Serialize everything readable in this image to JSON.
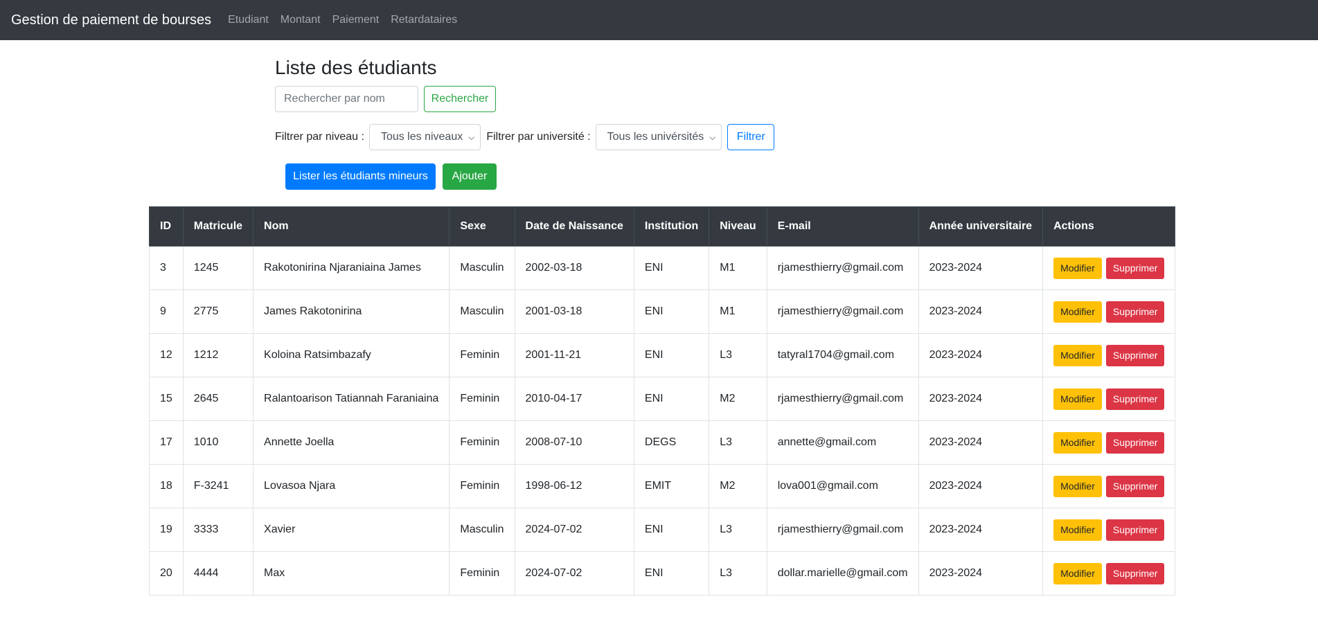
{
  "navbar": {
    "brand": "Gestion de paiement de bourses",
    "links": [
      "Etudiant",
      "Montant",
      "Paiement",
      "Retardataires"
    ]
  },
  "page": {
    "title": "Liste des étudiants"
  },
  "search": {
    "placeholder": "Rechercher par nom",
    "button": "Rechercher"
  },
  "filters": {
    "level_label": "Filtrer par niveau :",
    "level_selected": "Tous les niveaux",
    "university_label": "Filtrer par université :",
    "university_selected": "Tous les univérsités",
    "button": "Filtrer"
  },
  "actions": {
    "minors_button": "Lister les étudiants mineurs",
    "add_button": "Ajouter"
  },
  "table": {
    "headers": [
      "ID",
      "Matricule",
      "Nom",
      "Sexe",
      "Date de Naissance",
      "Institution",
      "Niveau",
      "E-mail",
      "Année universitaire",
      "Actions"
    ],
    "edit_label": "Modifier",
    "delete_label": "Supprimer",
    "rows": [
      [
        "3",
        "1245",
        "Rakotonirina Njaraniaina James",
        "Masculin",
        "2002-03-18",
        "ENI",
        "M1",
        "rjamesthierry@gmail.com",
        "2023-2024"
      ],
      [
        "9",
        "2775",
        "James Rakotonirina",
        "Masculin",
        "2001-03-18",
        "ENI",
        "M1",
        "rjamesthierry@gmail.com",
        "2023-2024"
      ],
      [
        "12",
        "1212",
        "Koloina Ratsimbazafy",
        "Feminin",
        "2001-11-21",
        "ENI",
        "L3",
        "tatyral1704@gmail.com",
        "2023-2024"
      ],
      [
        "15",
        "2645",
        "Ralantoarison Tatiannah Faraniaina",
        "Feminin",
        "2010-04-17",
        "ENI",
        "M2",
        "rjamesthierry@gmail.com",
        "2023-2024"
      ],
      [
        "17",
        "1010",
        "Annette Joella",
        "Feminin",
        "2008-07-10",
        "DEGS",
        "L3",
        "annette@gmail.com",
        "2023-2024"
      ],
      [
        "18",
        "F-3241",
        "Lovasoa Njara",
        "Feminin",
        "1998-06-12",
        "EMIT",
        "M2",
        "lova001@gmail.com",
        "2023-2024"
      ],
      [
        "19",
        "3333",
        "Xavier",
        "Masculin",
        "2024-07-02",
        "ENI",
        "L3",
        "rjamesthierry@gmail.com",
        "2023-2024"
      ],
      [
        "20",
        "4444",
        "Max",
        "Feminin",
        "2024-07-02",
        "ENI",
        "L3",
        "dollar.marielle@gmail.com",
        "2023-2024"
      ]
    ]
  },
  "colors": {
    "navbar_bg": "#343a40",
    "primary": "#007bff",
    "success": "#28a745",
    "warning": "#ffc107",
    "danger": "#dc3545"
  }
}
